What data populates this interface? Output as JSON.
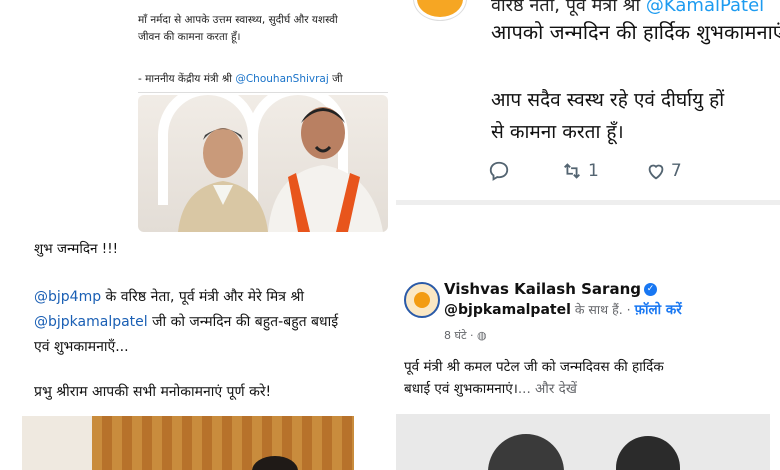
{
  "top_left": {
    "quote_lines": [
      "माँ नर्मदा से आपके उत्तम स्वास्थ्य, सुदीर्घ और यशस्वी",
      "जीवन की कामना करता हूँ।"
    ],
    "signature_prefix": "- माननीय केंद्रीय मंत्री श्री ",
    "signature_mention": "@ChouhanShivraj",
    "signature_suffix": " जी"
  },
  "top_right": {
    "line1_prefix": "वरिष्ठ नेता, पूर्व मंत्री श्री ",
    "line1_mention": "@KamalPatel",
    "line2": "आपको जन्मदिन की हार्दिक शुभकामनाएं।",
    "line3": "आप सदैव स्वस्थ रहे एवं दीर्घायु हों",
    "line4": "से कामना करता हूँ।",
    "retweet_count": "1",
    "like_count": "7",
    "icons": [
      "reply-icon",
      "retweet-icon",
      "like-icon"
    ]
  },
  "middle_left": {
    "greeting": "शुभ जन्मदिन !!!",
    "p1_line1_mention": "@bjp4mp",
    "p1_line1_text": " के वरिष्ठ नेता, पूर्व मंत्री और मेरे मित्र श्री",
    "p1_line2_mention": "@bjpkamalpatel",
    "p1_line2_text": " जी को जन्मदिन की बहुत-बहुत बधाई",
    "p1_line3": "एवं शुभकामनाएँ...",
    "p2": "प्रभु श्रीराम आपकी सभी मनोकामनाएं पूर्ण करे!"
  },
  "bottom_right": {
    "name": "Vishvas Kailash Sarang",
    "verified_glyph": "✓",
    "handle": "@bjpkamalpatel",
    "with_text": " के साथ हैं.",
    "separator": " · ",
    "follow_label": "फ़ॉलो करें",
    "time": "8 घंटे",
    "time_separator": " · ",
    "privacy_glyph": "◍",
    "body_line1": "पूर्व मंत्री श्री कमल पटेल जी को जन्मदिवस की हार्दिक",
    "body_line2": "बधाई एवं शुभकामनाएं।",
    "see_more": "... और देखें"
  },
  "colors": {
    "twitter_blue": "#1d9bf0",
    "facebook_blue": "#1877f2",
    "mention_blue": "#1a5fb4",
    "muted_gray": "#536471"
  }
}
